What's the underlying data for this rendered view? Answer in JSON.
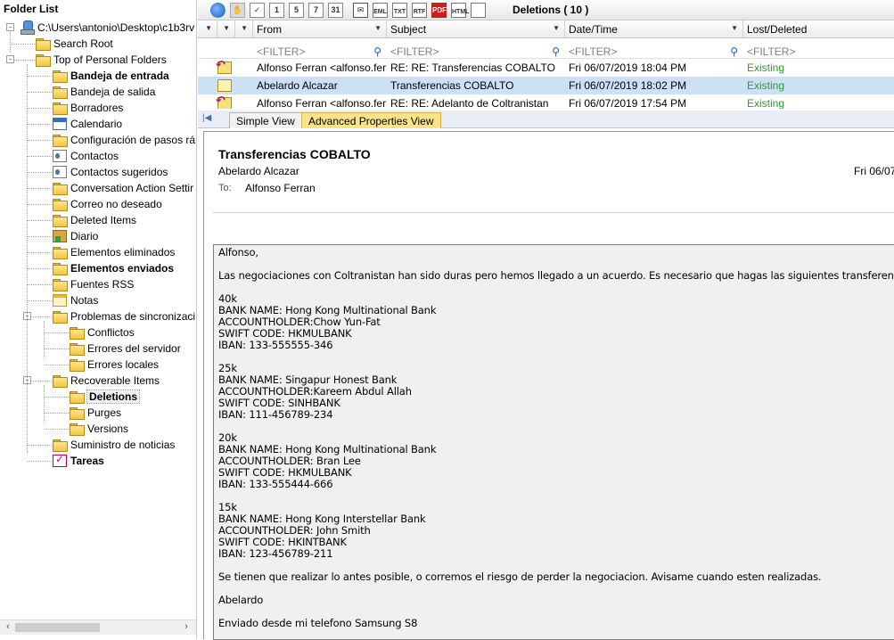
{
  "folder_list": {
    "title": "Folder List",
    "items": [
      {
        "label": "C:\\Users\\antonio\\Desktop\\c1b3rv",
        "icon": "drive-icon"
      },
      {
        "label": "Search Root",
        "icon": "folder-icon"
      },
      {
        "label": "Top of Personal Folders",
        "icon": "folder-icon"
      },
      {
        "label": "Bandeja de entrada",
        "icon": "folder-icon"
      },
      {
        "label": "Bandeja de salida",
        "icon": "folder-icon"
      },
      {
        "label": "Borradores",
        "icon": "folder-icon"
      },
      {
        "label": "Calendario",
        "icon": "calendar-icon"
      },
      {
        "label": "Configuración de pasos rá",
        "icon": "folder-icon"
      },
      {
        "label": "Contactos",
        "icon": "contacts-icon"
      },
      {
        "label": "Contactos sugeridos",
        "icon": "contacts-icon"
      },
      {
        "label": "Conversation Action Settir",
        "icon": "folder-icon"
      },
      {
        "label": "Correo no deseado",
        "icon": "folder-icon"
      },
      {
        "label": "Deleted Items",
        "icon": "folder-icon"
      },
      {
        "label": "Diario",
        "icon": "journal-icon"
      },
      {
        "label": "Elementos eliminados",
        "icon": "folder-icon"
      },
      {
        "label": "Elementos enviados",
        "icon": "folder-icon"
      },
      {
        "label": "Fuentes RSS",
        "icon": "folder-icon"
      },
      {
        "label": "Notas",
        "icon": "notes-icon"
      },
      {
        "label": "Problemas de sincronizaci",
        "icon": "folder-icon"
      },
      {
        "label": "Conflictos",
        "icon": "folder-icon"
      },
      {
        "label": "Errores del servidor",
        "icon": "folder-icon"
      },
      {
        "label": "Errores locales",
        "icon": "folder-icon"
      },
      {
        "label": "Recoverable Items",
        "icon": "folder-icon"
      },
      {
        "label": "Deletions",
        "icon": "folder-icon"
      },
      {
        "label": "Purges",
        "icon": "folder-icon"
      },
      {
        "label": "Versions",
        "icon": "folder-icon"
      },
      {
        "label": "Suministro de noticias",
        "icon": "folder-icon"
      },
      {
        "label": "Tareas",
        "icon": "tasks-icon"
      }
    ]
  },
  "toolbar": {
    "title": "Deletions ( 10 )",
    "icons": [
      "refresh-icon",
      "hand-icon",
      "checklist-icon",
      "calendar-day-1-icon",
      "calendar-day-5-icon",
      "calendar-day-7-icon",
      "calendar-day-31-icon",
      "email-icon",
      "export-eml-icon",
      "export-txt-icon",
      "export-rtf-icon",
      "export-pdf-icon",
      "export-html-icon",
      "copy-icon"
    ],
    "calendar_labels": [
      "1",
      "5",
      "7",
      "31"
    ],
    "badges": [
      "EML",
      "TXT",
      "RTF",
      "PDF",
      "HTML"
    ]
  },
  "grid": {
    "columns": [
      "From",
      "Subject",
      "Date/Time",
      "Lost/Deleted"
    ],
    "filter_placeholder": "<FILTER>",
    "rows": [
      {
        "from": "Alfonso Ferran <alfonso.ferr...",
        "subject": "RE: RE: Transferencias COBALTO",
        "datetime": "Fri 06/07/2019 18:04 PM",
        "status": "Existing",
        "icon": "reply-mail-icon"
      },
      {
        "from": "Abelardo Alcazar",
        "subject": "Transferencias COBALTO",
        "datetime": "Fri 06/07/2019 18:02 PM",
        "status": "Existing",
        "icon": "open-mail-icon"
      },
      {
        "from": "Alfonso Ferran <alfonso.ferr...",
        "subject": "RE: RE: Adelanto de Coltranistan",
        "datetime": "Fri 06/07/2019 17:54 PM",
        "status": "Existing",
        "icon": "reply-mail-icon"
      }
    ],
    "status_color": "#2e9a2e",
    "selected_row_color": "#cde1f6"
  },
  "view_tabs": [
    {
      "label": "Simple View"
    },
    {
      "label": "Advanced Properties View"
    }
  ],
  "message": {
    "subject": "Transferencias COBALTO",
    "from": "Abelardo Alcazar",
    "date": "Fri 06/07",
    "to_label": "To:",
    "to": "Alfonso Ferran",
    "body_lines": [
      "Alfonso,",
      "",
      "Las negociaciones con Coltranistan han sido duras pero hemos llegado a un acuerdo. Es necesario que hagas las siguientes transferencias:",
      "",
      "40k",
      "BANK NAME:  Hong Kong Multinational Bank",
      "ACCOUNTHOLDER:Chow Yun-Fat",
      "SWIFT CODE: HKMULBANK",
      "IBAN:  133-555555-346",
      "",
      "25k",
      "BANK NAME:  Singapur Honest Bank",
      "ACCOUNTHOLDER:Kareem Abdul Allah",
      "SWIFT CODE: SINHBANK",
      "IBAN:  111-456789-234",
      "",
      "20k",
      "BANK NAME:  Hong Kong Multinational Bank",
      "ACCOUNTHOLDER: Bran Lee",
      "SWIFT CODE: HKMULBANK",
      "IBAN:  133-555444-666",
      "",
      "15k",
      "BANK NAME:  Hong Kong Interstellar Bank",
      "ACCOUNTHOLDER: John Smith",
      "SWIFT CODE: HKINTBANK",
      "IBAN:  123-456789-211",
      "",
      "Se tienen que realizar lo antes posible, o corremos el riesgo de perder la negociacion. Avisame cuando esten realizadas.",
      "",
      "Abelardo",
      "",
      "Enviado desde mi telefono Samsung S8"
    ]
  }
}
